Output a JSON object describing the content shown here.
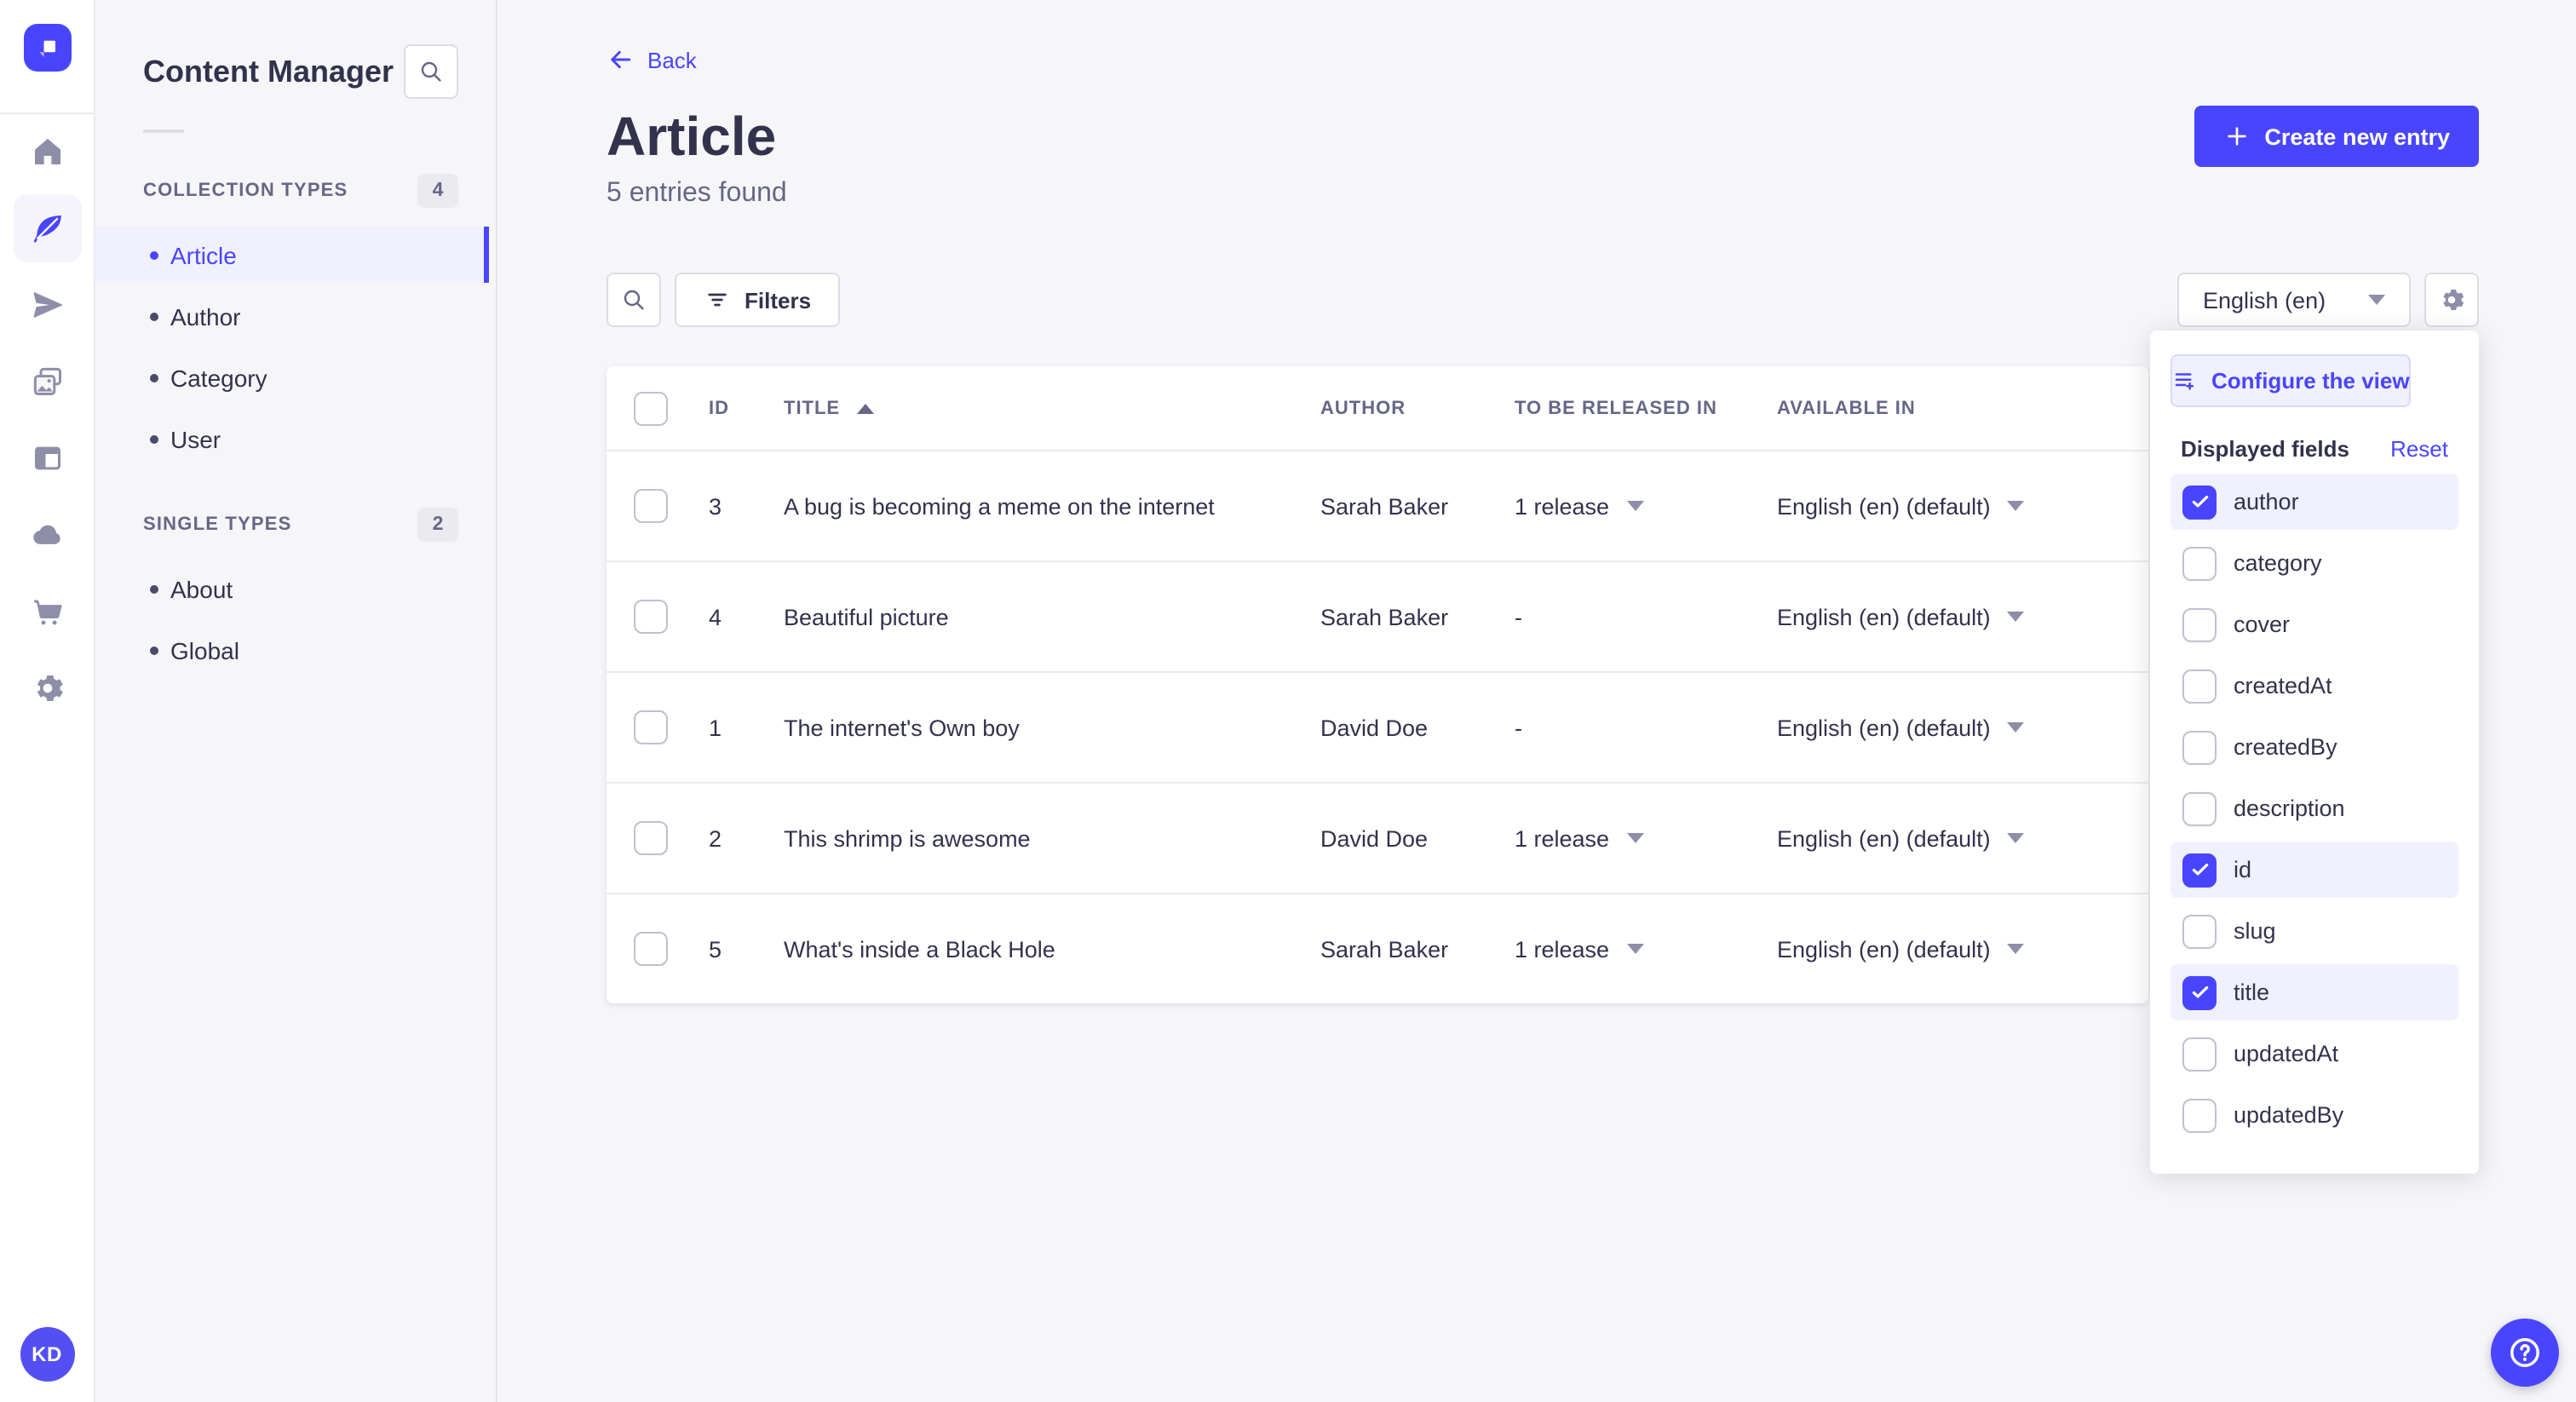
{
  "colors": {
    "brand": "#4945ff",
    "brand_light": "#f0f0ff",
    "page_bg": "#f6f6f9",
    "text": "#32324d",
    "muted": "#666687"
  },
  "rail": {
    "logo_icon": "strapi-logo",
    "items": [
      {
        "icon": "home-icon",
        "active": false
      },
      {
        "icon": "content-feather-icon",
        "active": true
      },
      {
        "icon": "paper-plane-icon",
        "active": false
      },
      {
        "icon": "media-library-icon",
        "active": false
      },
      {
        "icon": "layout-icon",
        "active": false
      },
      {
        "icon": "cloud-icon",
        "active": false
      },
      {
        "icon": "marketplace-cart-icon",
        "active": false
      },
      {
        "icon": "settings-gear-icon",
        "active": false
      }
    ],
    "avatar_initials": "KD"
  },
  "sidebar": {
    "title": "Content Manager",
    "search_icon": "search-icon",
    "sections": [
      {
        "label": "COLLECTION TYPES",
        "badge": "4",
        "items": [
          {
            "label": "Article",
            "active": true
          },
          {
            "label": "Author",
            "active": false
          },
          {
            "label": "Category",
            "active": false
          },
          {
            "label": "User",
            "active": false
          }
        ]
      },
      {
        "label": "SINGLE TYPES",
        "badge": "2",
        "items": [
          {
            "label": "About",
            "active": false
          },
          {
            "label": "Global",
            "active": false
          }
        ]
      }
    ]
  },
  "header": {
    "back_label": "Back",
    "title": "Article",
    "subtitle": "5 entries found",
    "create_label": "Create new entry"
  },
  "toolbar": {
    "filters_label": "Filters",
    "locale_value": "English (en)"
  },
  "table": {
    "columns": [
      "ID",
      "TITLE",
      "AUTHOR",
      "TO BE RELEASED IN",
      "AVAILABLE IN"
    ],
    "sorted_column": "TITLE",
    "sort_direction": "asc",
    "rows": [
      {
        "id": "3",
        "title": "A bug is becoming a meme on the internet",
        "author": "Sarah Baker",
        "releases": "1 release",
        "locale": "English (en) (default)"
      },
      {
        "id": "4",
        "title": "Beautiful picture",
        "author": "Sarah Baker",
        "releases": "-",
        "locale": "English (en) (default)"
      },
      {
        "id": "1",
        "title": "The internet's Own boy",
        "author": "David Doe",
        "releases": "-",
        "locale": "English (en) (default)"
      },
      {
        "id": "2",
        "title": "This shrimp is awesome",
        "author": "David Doe",
        "releases": "1 release",
        "locale": "English (en) (default)"
      },
      {
        "id": "5",
        "title": "What's inside a Black Hole",
        "author": "Sarah Baker",
        "releases": "1 release",
        "locale": "English (en) (default)"
      }
    ]
  },
  "popover": {
    "configure_label": "Configure the view",
    "fields_label": "Displayed fields",
    "reset_label": "Reset",
    "fields": [
      {
        "label": "author",
        "checked": true
      },
      {
        "label": "category",
        "checked": false
      },
      {
        "label": "cover",
        "checked": false
      },
      {
        "label": "createdAt",
        "checked": false
      },
      {
        "label": "createdBy",
        "checked": false
      },
      {
        "label": "description",
        "checked": false
      },
      {
        "label": "id",
        "checked": true
      },
      {
        "label": "slug",
        "checked": false
      },
      {
        "label": "title",
        "checked": true
      },
      {
        "label": "updatedAt",
        "checked": false
      },
      {
        "label": "updatedBy",
        "checked": false
      }
    ]
  }
}
